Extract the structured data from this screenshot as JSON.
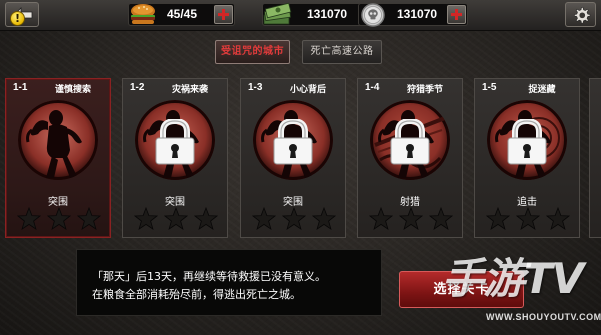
{
  "topbar": {
    "back_icon": "back-arrow-icon",
    "alert_badge": "!",
    "energy": {
      "icon": "burger-icon",
      "value": "45/45"
    },
    "cash": {
      "icon": "cash-stack-icon",
      "value": "131070"
    },
    "coins": {
      "icon": "skull-coin-icon",
      "value": "131070"
    },
    "settings_icon": "gear-icon"
  },
  "tabs": [
    {
      "label": "受诅咒的城市",
      "active": true
    },
    {
      "label": "死亡高速公路",
      "active": false
    }
  ],
  "levels": [
    {
      "number": "1-1",
      "name": "谨慎搜索",
      "objective": "突围",
      "stars": 3,
      "locked": false,
      "selected": true
    },
    {
      "number": "1-2",
      "name": "灾祸来袭",
      "objective": "突围",
      "stars": 3,
      "locked": true,
      "selected": false
    },
    {
      "number": "1-3",
      "name": "小心背后",
      "objective": "突围",
      "stars": 3,
      "locked": true,
      "selected": false
    },
    {
      "number": "1-4",
      "name": "狩猎季节",
      "objective": "射猎",
      "stars": 3,
      "locked": true,
      "selected": false
    },
    {
      "number": "1-5",
      "name": "捉迷藏",
      "objective": "追击",
      "stars": 3,
      "locked": true,
      "selected": false
    }
  ],
  "story": {
    "line1": "「那天」后13天，再继续等待救援已没有意义。",
    "line2": "在粮食全部消耗殆尽前，得逃出死亡之城。"
  },
  "select_button": "选择关卡",
  "watermark": {
    "logo": "手游TV",
    "url": "WWW.SHOUYOUTV.COM"
  },
  "colors": {
    "selected_card_border": "#8a2222",
    "active_tab_text": "#e23b3b",
    "select_button": "#9b1f1f",
    "plus_cross": "#d12626"
  }
}
